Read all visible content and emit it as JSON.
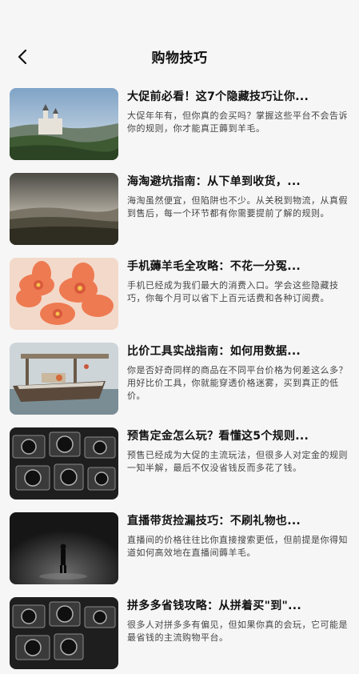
{
  "header": {
    "title": "购物技巧",
    "back_icon": "chevron-left-icon"
  },
  "articles": [
    {
      "title": "大促前必看！这7个隐藏技巧让你...",
      "summary": "大促年年有，但你真的会买吗？掌握这些平台不会告诉你的规则，你才能真正薅到羊毛。"
    },
    {
      "title": "海淘避坑指南：从下单到收货，...",
      "summary": "海淘虽然便宜，但陷阱也不少。从关税到物流，从真假到售后，每一个环节都有你需要提前了解的规则。"
    },
    {
      "title": "手机薅羊毛全攻略：不花一分冤...",
      "summary": "手机已经成为我们最大的消费入口。学会这些隐藏技巧，你每个月可以省下上百元话费和各种订阅费。"
    },
    {
      "title": "比价工具实战指南：如何用数据...",
      "summary": "你是否好奇同样的商品在不同平台价格为何差这么多？用好比价工具，你就能穿透价格迷雾，买到真正的低价。"
    },
    {
      "title": "预售定金怎么玩？看懂这5个规则...",
      "summary": "预售已经成为大促的主流玩法，但很多人对定金的规则一知半解，最后不仅没省钱反而多花了钱。"
    },
    {
      "title": "直播带货捡漏技巧：不刷礼物也...",
      "summary": "直播间的价格往往比你直接搜索更低，但前提是你得知道如何高效地在直播间薅羊毛。"
    },
    {
      "title": "拼多多省钱攻略：从拼着买\"到\"...",
      "summary": "很多人对拼多多有偏见，但如果你真的会玩，它可能是最省钱的主流购物平台。"
    }
  ]
}
